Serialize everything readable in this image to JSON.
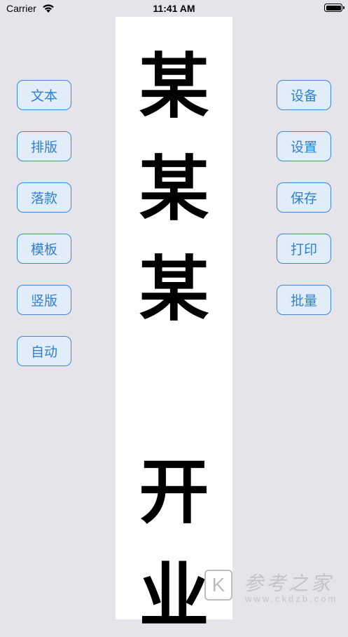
{
  "status_bar": {
    "carrier": "Carrier",
    "time": "11:41 AM",
    "wifi_icon": "wifi-icon",
    "battery_icon": "battery-icon"
  },
  "preview": {
    "characters": [
      "某",
      "某",
      "某",
      "开",
      "业"
    ]
  },
  "left_buttons": [
    "文本",
    "排版",
    "落款",
    "模板",
    "竖版",
    "自动"
  ],
  "right_buttons": [
    "设备",
    "设置",
    "保存",
    "打印",
    "批量"
  ],
  "watermark": {
    "logo": "K",
    "title": "参考之家",
    "url": "www.ckdzb.com"
  },
  "colors": {
    "background": "#e5e4ea",
    "button_border": "#3d88d6",
    "button_fill": "#e2edfa",
    "button_text": "#2f7fd4"
  }
}
